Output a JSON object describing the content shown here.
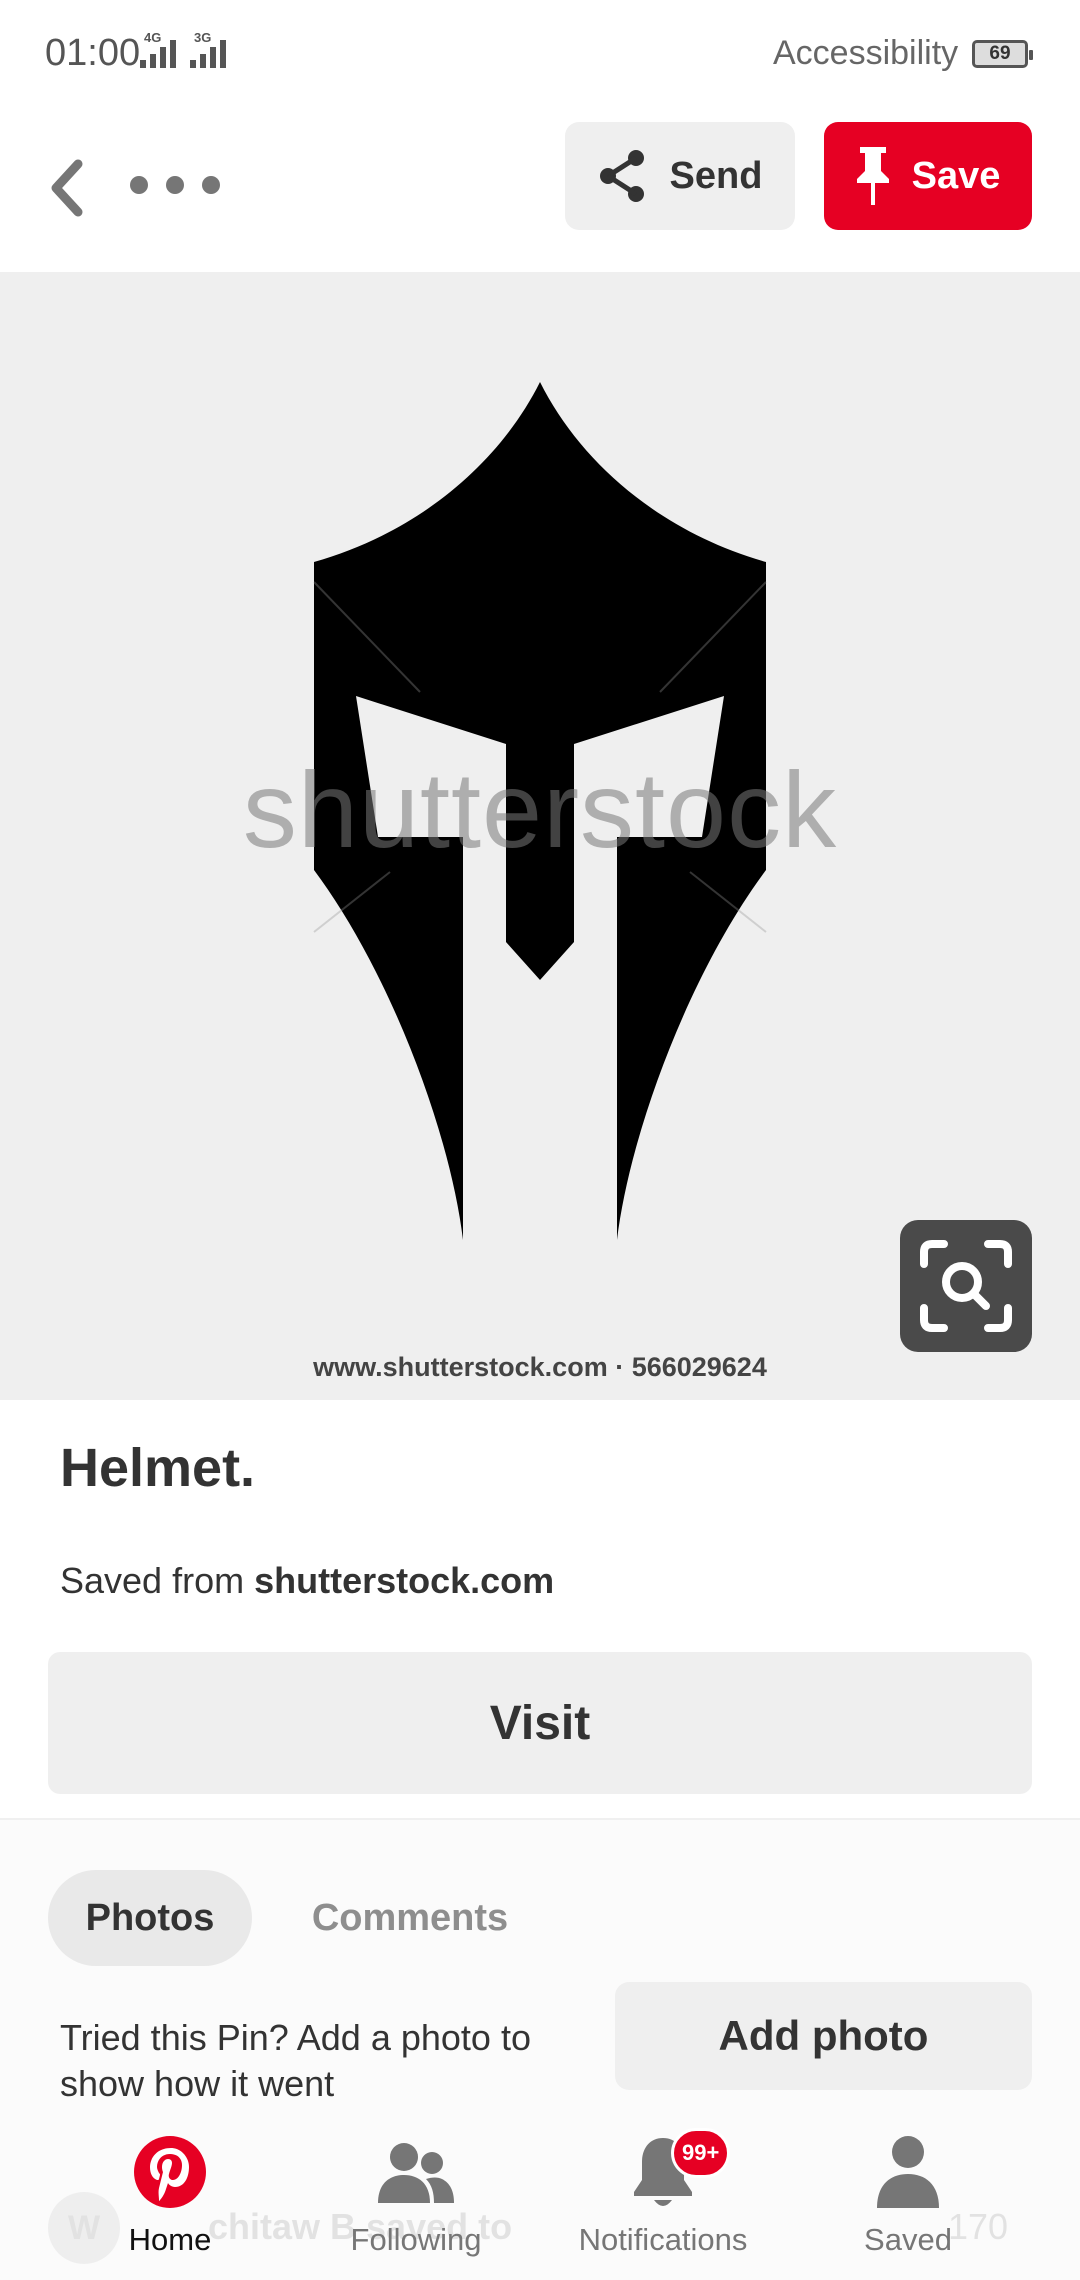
{
  "status_bar": {
    "time": "01:00",
    "network_1": "4G",
    "network_2": "3G",
    "accessibility": "Accessibility",
    "battery": "69"
  },
  "toolbar": {
    "back_icon": "chevron-left-icon",
    "more_icon": "more-horizontal-icon",
    "send_label": "Send",
    "send_icon": "share-icon",
    "save_label": "Save",
    "save_icon": "pushpin-icon",
    "save_color": "#e60023"
  },
  "pin": {
    "watermark": "shutterstock",
    "credit": "www.shutterstock.com · 566029624",
    "lens_icon": "visual-search-icon",
    "title": "Helmet.",
    "saved_from_prefix": "Saved from ",
    "saved_from_domain": "shutterstock.com",
    "visit_label": "Visit"
  },
  "tabs": {
    "photos": "Photos",
    "comments": "Comments",
    "active": "Photos"
  },
  "tried": {
    "text": "Tried this Pin? Add a photo to show how it went",
    "add_photo_label": "Add photo"
  },
  "faded_row": {
    "avatar": "W",
    "text": "chitaw B     saved to",
    "count": "170"
  },
  "bottom_nav": {
    "items": [
      {
        "label": "Home",
        "icon": "pinterest-logo-icon",
        "active": true
      },
      {
        "label": "Following",
        "icon": "people-icon",
        "active": false
      },
      {
        "label": "Notifications",
        "icon": "bell-icon",
        "active": false,
        "badge": "99+"
      },
      {
        "label": "Saved",
        "icon": "person-icon",
        "active": false
      }
    ]
  }
}
